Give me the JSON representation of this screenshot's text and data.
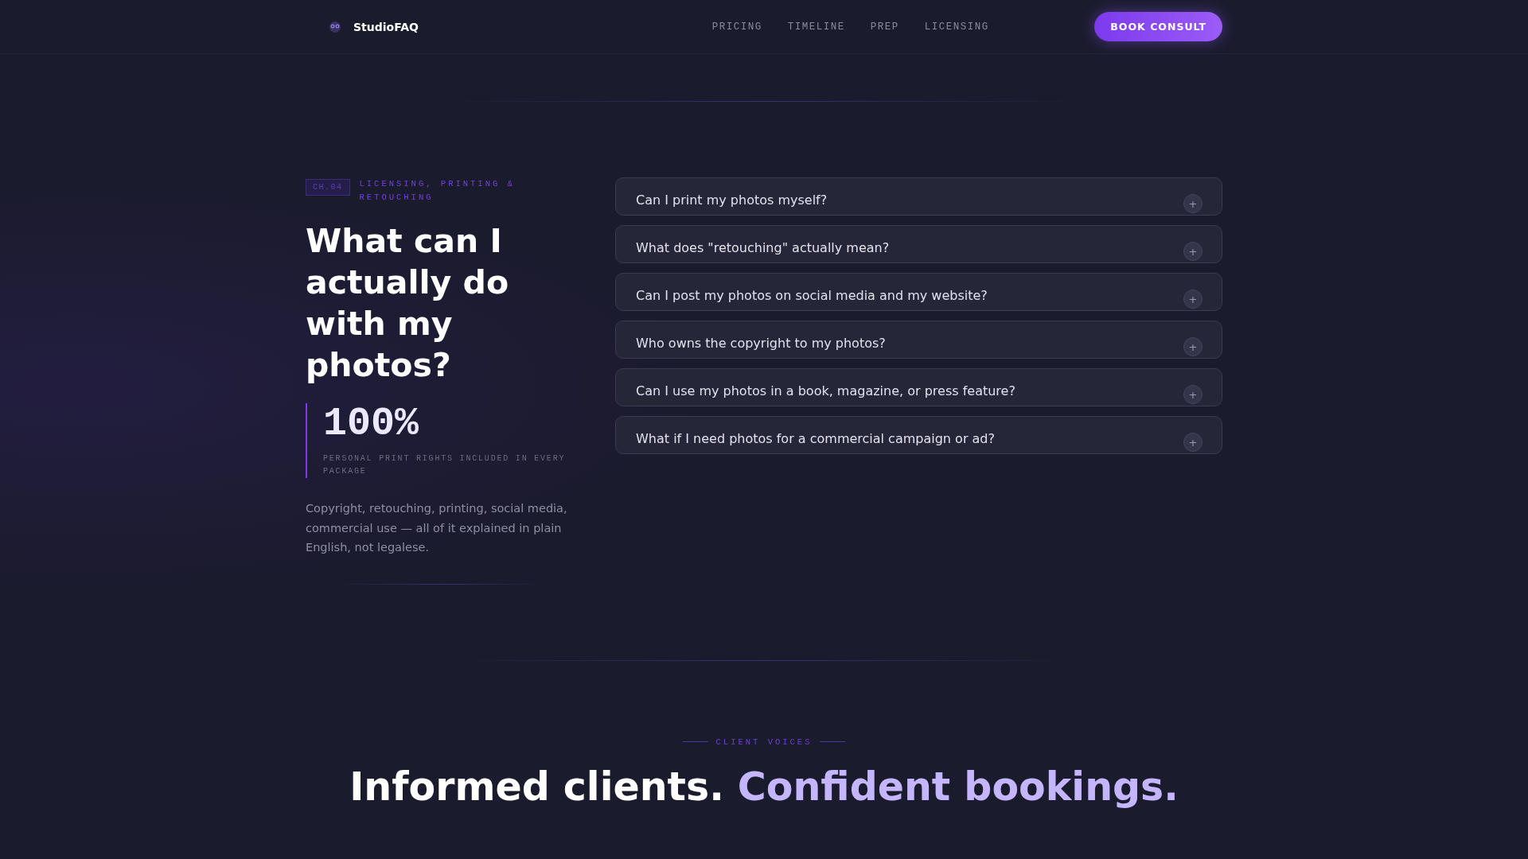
{
  "nav": {
    "brand": "StudioFAQ",
    "links": [
      "PRICING",
      "TIMELINE",
      "PREP",
      "LICENSING"
    ],
    "cta": "BOOK CONSULT"
  },
  "chapter": {
    "badge": "CH.04",
    "eyebrow": "LICENSING, PRINTING & RETOUCHING",
    "title": "What can I actually do with my photos?",
    "stat": {
      "value": "100%",
      "caption": "PERSONAL PRINT RIGHTS INCLUDED IN EVERY PACKAGE"
    },
    "intro": "Copyright, retouching, printing, social media, commercial use — all of it explained in plain English, not legalese."
  },
  "faq": [
    {
      "question": "Can I print my photos myself?",
      "expanded": false,
      "toggle": "+"
    },
    {
      "question": "What does \"retouching\" actually mean?",
      "expanded": false,
      "toggle": "+"
    },
    {
      "question": "Can I post my photos on social media and my website?",
      "expanded": false,
      "toggle": "+"
    },
    {
      "question": "Who owns the copyright to my photos?",
      "expanded": false,
      "toggle": "+"
    },
    {
      "question": "Can I use my photos in a book, magazine, or press feature?",
      "expanded": false,
      "toggle": "+"
    },
    {
      "question": "What if I need photos for a commercial campaign or ad?",
      "expanded": false,
      "toggle": "+"
    }
  ],
  "testimonials": {
    "eyebrow": "CLIENT VOICES",
    "title": "Informed clients.",
    "title_accent": "Confident bookings."
  }
}
